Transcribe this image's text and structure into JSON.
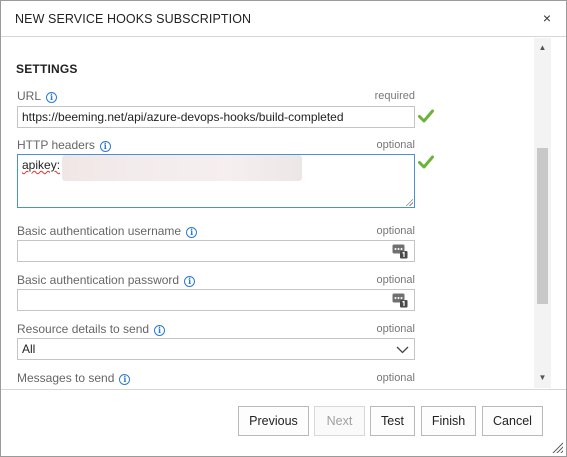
{
  "dialog": {
    "title": "NEW SERVICE HOOKS SUBSCRIPTION",
    "close_glyph": "×"
  },
  "settings": {
    "section_title": "SETTINGS",
    "url": {
      "label": "URL",
      "requirement": "required",
      "value": "https://beeming.net/api/azure-devops-hooks/build-completed",
      "valid": true
    },
    "http_headers": {
      "label": "HTTP headers",
      "requirement": "optional",
      "value_prefix": "apikey:",
      "valid": true
    },
    "basic_auth_username": {
      "label": "Basic authentication username",
      "requirement": "optional",
      "value": ""
    },
    "basic_auth_password": {
      "label": "Basic authentication password",
      "requirement": "optional",
      "value": ""
    },
    "resource_details": {
      "label": "Resource details to send",
      "requirement": "optional",
      "selected": "All"
    },
    "messages": {
      "label": "Messages to send",
      "requirement": "optional"
    }
  },
  "footer": {
    "previous_label": "Previous",
    "next_label": "Next",
    "test_label": "Test",
    "finish_label": "Finish",
    "cancel_label": "Cancel"
  },
  "icons": {
    "info": "info-icon",
    "valid": "checkmark-icon",
    "credential": "key-icon",
    "dropdown": "chevron-down-icon",
    "close": "close-icon"
  },
  "colors": {
    "accent_blue": "#2a7ad5",
    "valid_green": "#6bb33a",
    "focus_border": "#4a90d9"
  }
}
